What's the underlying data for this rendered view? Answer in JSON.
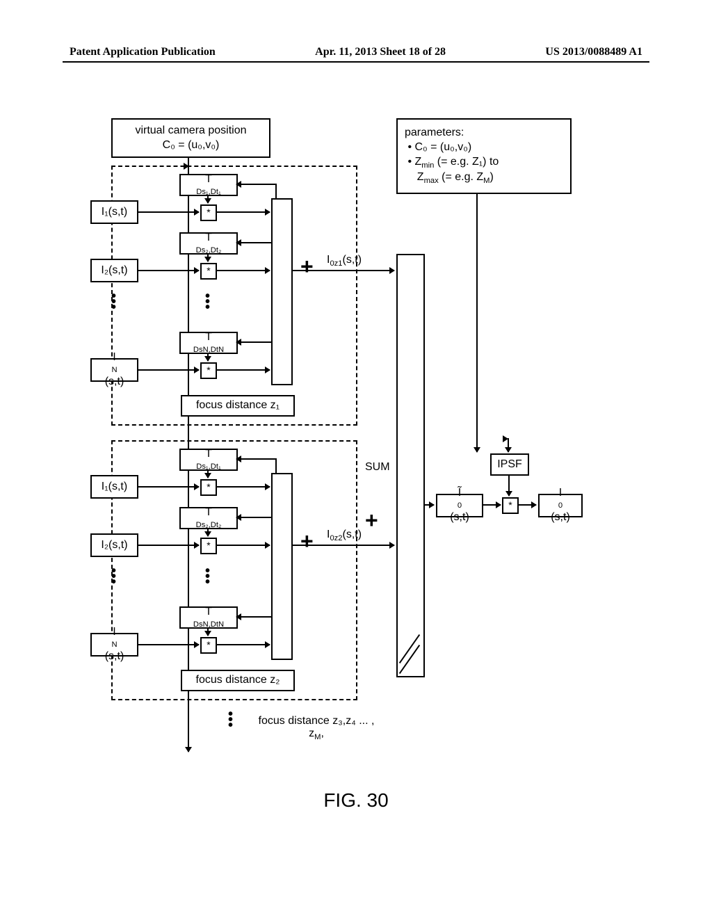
{
  "header": {
    "left": "Patent Application Publication",
    "center": "Apr. 11, 2013  Sheet 18 of 28",
    "right": "US 2013/0088489 A1"
  },
  "top_boxes": {
    "virtual_camera": {
      "line1": "virtual camera position",
      "line2": "C₀ = (u₀,v₀)"
    },
    "parameters": {
      "title": "parameters:",
      "bullet1": "C₀ = (u₀,v₀)",
      "bullet2_a": "Z",
      "bullet2_b": "min",
      "bullet2_c": " (= e.g. Z₁) to",
      "bullet3_a": "Z",
      "bullet3_b": "max",
      "bullet3_c": " (= e.g. Z",
      "bullet3_d": "M",
      "bullet3_e": ")"
    }
  },
  "inputs": {
    "i1": "I₁(s,t)",
    "i2": "I₂(s,t)",
    "in": "I",
    "in_sub": "N",
    "in_tail": "(s,t)"
  },
  "transforms": {
    "t1": "T",
    "t1_sub": "Ds₁,Dt₁",
    "t2": "T",
    "t2_sub": "Ds₂,Dt₂",
    "tn": "T",
    "tn_sub": "DsN,DtN"
  },
  "focus_labels": {
    "z1": "focus distance z₁",
    "z2": "focus distance z₂",
    "z3": "focus distance z₃,z₄ ... ,",
    "zm": "z",
    "zm_sub": "M",
    "zm_tail": ","
  },
  "outputs": {
    "i0z1": "I",
    "i0z1_sub": "0z1",
    "i0z1_tail": "(s,t)",
    "i0z2": "I",
    "i0z2_sub": "0z2",
    "i0z2_tail": "(s,t)",
    "i0tilde_pre": "Ĩ",
    "i0tilde_sub": "0",
    "i0tilde_tail": "(s,t)",
    "i0": "I",
    "i0_sub": "0",
    "i0_tail": "(s,t)"
  },
  "blocks": {
    "sum": "SUM",
    "ipsf": "IPSF"
  },
  "figure": "FIG. 30"
}
